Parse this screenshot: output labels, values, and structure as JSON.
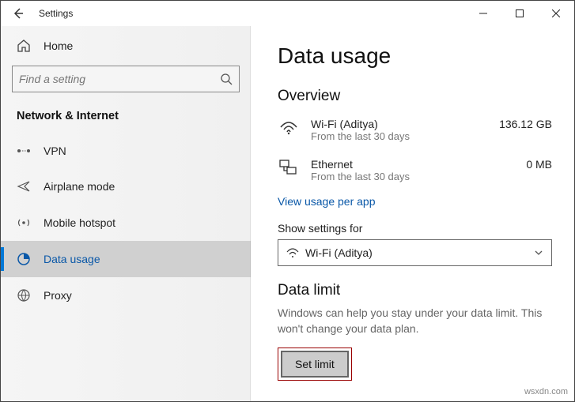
{
  "window": {
    "title": "Settings",
    "watermark": "wsxdn.com"
  },
  "sidebar": {
    "home": "Home",
    "search_placeholder": "Find a setting",
    "section": "Network & Internet",
    "items": [
      {
        "label": "VPN"
      },
      {
        "label": "Airplane mode"
      },
      {
        "label": "Mobile hotspot"
      },
      {
        "label": "Data usage"
      },
      {
        "label": "Proxy"
      }
    ]
  },
  "main": {
    "title": "Data usage",
    "overview_heading": "Overview",
    "networks": [
      {
        "name": "Wi-Fi (Aditya)",
        "subtitle": "From the last 30 days",
        "value": "136.12 GB"
      },
      {
        "name": "Ethernet",
        "subtitle": "From the last 30 days",
        "value": "0 MB"
      }
    ],
    "view_link": "View usage per app",
    "show_label": "Show settings for",
    "dropdown_value": "Wi-Fi (Aditya)",
    "limit_heading": "Data limit",
    "limit_desc": "Windows can help you stay under your data limit. This won't change your data plan.",
    "set_limit_label": "Set limit"
  }
}
